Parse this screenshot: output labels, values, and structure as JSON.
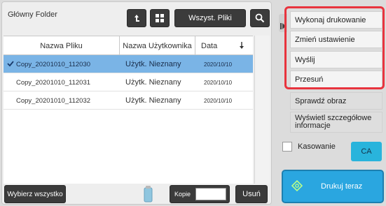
{
  "header": {
    "folder_title": "Główny Folder",
    "filter_label": "Wszyst. Pliki"
  },
  "table": {
    "columns": [
      "Nazwa Pliku",
      "Nazwa Użytkownika",
      "Data"
    ],
    "rows": [
      {
        "file": "Copy_20201010_112030",
        "user": "Użytk. Nieznany",
        "date": "2020/10/10",
        "selected": true
      },
      {
        "file": "Copy_20201010_112031",
        "user": "Użytk. Nieznany",
        "date": "2020/10/10",
        "selected": false
      },
      {
        "file": "Copy_20201010_112032",
        "user": "Użytk. Nieznany",
        "date": "2020/10/10",
        "selected": false
      }
    ]
  },
  "bottom": {
    "select_all": "Wybierz wszystko",
    "copies_label": "Kopie",
    "copies_value": "",
    "delete": "Usuń"
  },
  "tasks": {
    "items": [
      "Wykonaj drukowanie",
      "Zmień ustawienie",
      "Wyślij",
      "Przesuń",
      "Sprawdź obraz",
      "Wyświetl szczegółowe informacje"
    ],
    "highlight_color": "#e8343e"
  },
  "delete_option": {
    "label": "Kasowanie",
    "checked": false
  },
  "actions": {
    "ca": "CA",
    "print_now": "Drukuj teraz"
  }
}
